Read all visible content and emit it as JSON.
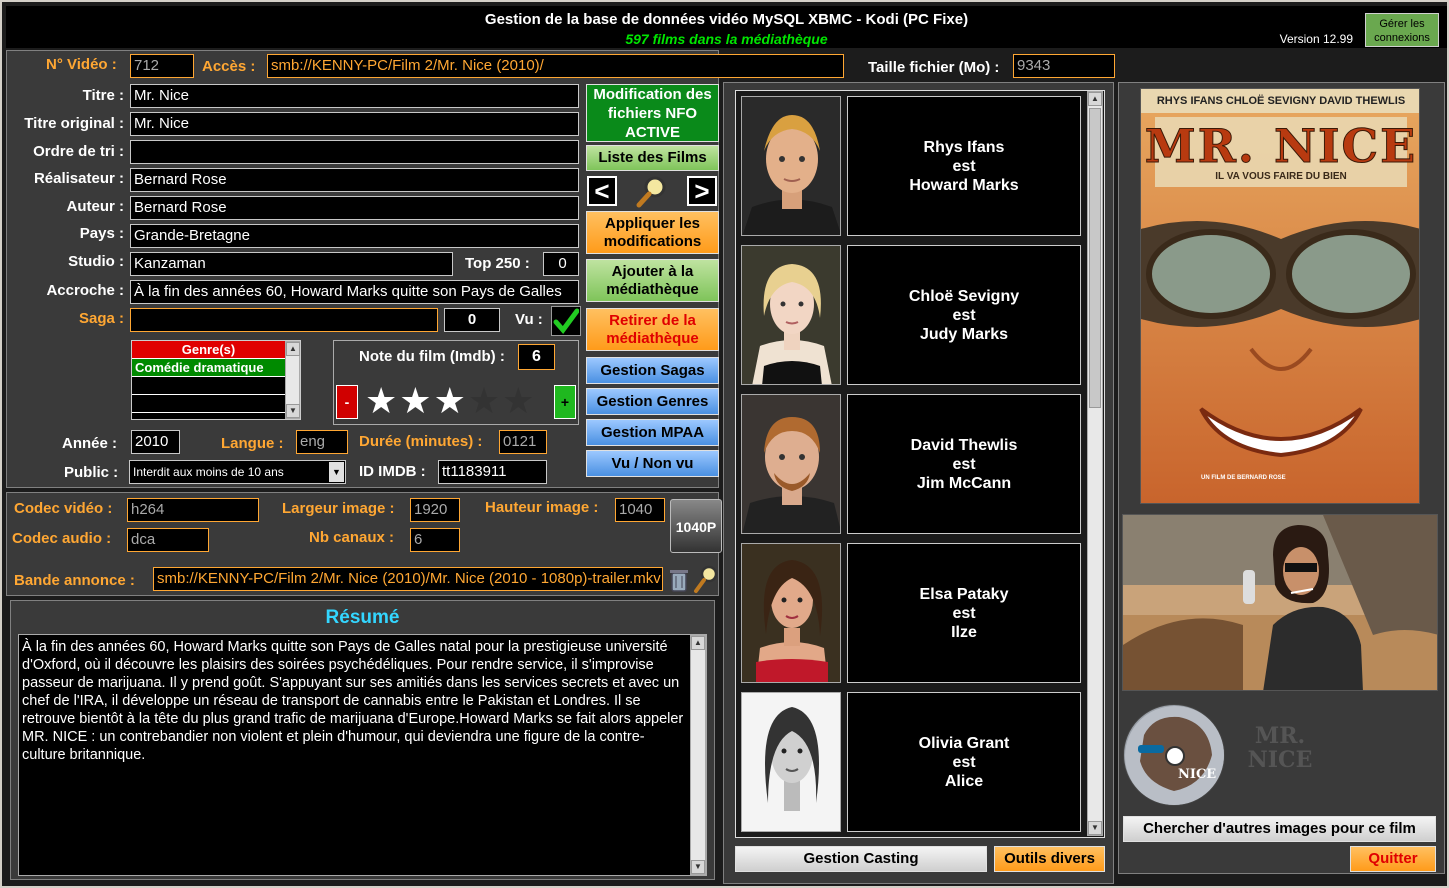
{
  "header": {
    "title": "Gestion de la base de données vidéo MySQL XBMC - Kodi (PC Fixe)",
    "subtitle": "597 films dans la médiathèque",
    "version": "Version 12.99",
    "manage_connections": "Gérer les connexions"
  },
  "file": {
    "video_no_label": "N° Vidéo :",
    "video_no": "712",
    "access_label": "Accès :",
    "access": "smb://KENNY-PC/Film 2/Mr. Nice (2010)/",
    "size_label": "Taille fichier (Mo) :",
    "size": "9343"
  },
  "movie": {
    "title_label": "Titre :",
    "title": "Mr. Nice",
    "original_title_label": "Titre original :",
    "original_title": "Mr. Nice",
    "sort_label": "Ordre de tri :",
    "sort": "",
    "director_label": "Réalisateur :",
    "director": "Bernard Rose",
    "author_label": "Auteur :",
    "author": "Bernard Rose",
    "country_label": "Pays :",
    "country": "Grande-Bretagne",
    "studio_label": "Studio :",
    "studio": "Kanzaman",
    "top250_label": "Top 250 :",
    "top250": "0",
    "tagline_label": "Accroche :",
    "tagline": "À la fin des années 60, Howard Marks quitte son Pays de Galles",
    "saga_label": "Saga :",
    "saga": "",
    "saga_no": "0",
    "seen_label": "Vu :",
    "genres_header": "Genre(s)",
    "genres": [
      "Comédie dramatique"
    ],
    "rating_label": "Note du film (Imdb) :",
    "rating": "6",
    "stars": 3,
    "stars_max": 5,
    "year_label": "Année :",
    "year": "2010",
    "language_label": "Langue :",
    "language": "eng",
    "duration_label": "Durée (minutes) :",
    "duration": "0121",
    "public_label": "Public :",
    "public": "Interdit aux moins de 10 ans",
    "imdb_label": "ID IMDB :",
    "imdb": "tt1183911"
  },
  "tech": {
    "vcodec_label": "Codec vidéo :",
    "vcodec": "h264",
    "width_label": "Largeur image :",
    "width": "1920",
    "height_label": "Hauteur image :",
    "height": "1040",
    "acodec_label": "Codec audio :",
    "acodec": "dca",
    "channels_label": "Nb canaux :",
    "channels": "6",
    "resolution_badge": "1040P",
    "trailer_label": "Bande annonce :",
    "trailer": "smb://KENNY-PC/Film 2/Mr. Nice (2010)/Mr. Nice (2010 - 1080p)-trailer.mkv"
  },
  "summary": {
    "title": "Résumé",
    "text": "À la fin des années 60, Howard Marks quitte son Pays de Galles natal pour la prestigieuse université d'Oxford, où il découvre les plaisirs des soirées psychédéliques. Pour rendre service, il s'improvise passeur de marijuana. Il y prend goût. S'appuyant sur ses amitiés dans les services secrets et avec un chef de l'IRA, il développe un réseau de transport de cannabis entre le Pakistan et Londres. Il se retrouve bientôt à la tête du plus grand trafic de marijuana d'Europe.Howard Marks se fait alors appeler MR. NICE : un contrebandier non violent et plein d'humour, qui deviendra une figure de la contre-culture britannique."
  },
  "actions": {
    "nfo": "Modification des fichiers NFO ACTIVE",
    "list": "Liste des Films",
    "apply": "Appliquer les modifications",
    "add": "Ajouter à la médiathèque",
    "remove": "Retirer de la médiathèque",
    "sagas": "Gestion Sagas",
    "genres": "Gestion Genres",
    "mpaa": "Gestion MPAA",
    "seen": "Vu / Non vu",
    "minus": "-",
    "plus": "+",
    "prev": "<",
    "next": ">"
  },
  "cast": [
    {
      "actor": "Rhys Ifans",
      "as": "est",
      "role": "Howard Marks"
    },
    {
      "actor": "Chloë Sevigny",
      "as": "est",
      "role": "Judy Marks"
    },
    {
      "actor": "David Thewlis",
      "as": "est",
      "role": "Jim McCann"
    },
    {
      "actor": "Elsa Pataky",
      "as": "est",
      "role": "Ilze"
    },
    {
      "actor": "Olivia Grant",
      "as": "est",
      "role": "Alice"
    }
  ],
  "cast_footer": {
    "casting": "Gestion Casting",
    "tools": "Outils divers"
  },
  "poster": {
    "actors_line": "RHYS IFANS  CHLOË SEVIGNY  DAVID THEWLIS",
    "title": "MR. NICE",
    "tagline": "IL VA VOUS FAIRE DU BIEN",
    "credit": "UN FILM DE BERNARD ROSE",
    "disc_label": "NICE",
    "clearlogo": "MR. NICE"
  },
  "images": {
    "search_more": "Chercher d'autres images pour ce film",
    "quit": "Quitter"
  },
  "colors": {
    "accent_orange": "#ffa733",
    "green": "#00e600",
    "background": "#1c1c1c"
  }
}
